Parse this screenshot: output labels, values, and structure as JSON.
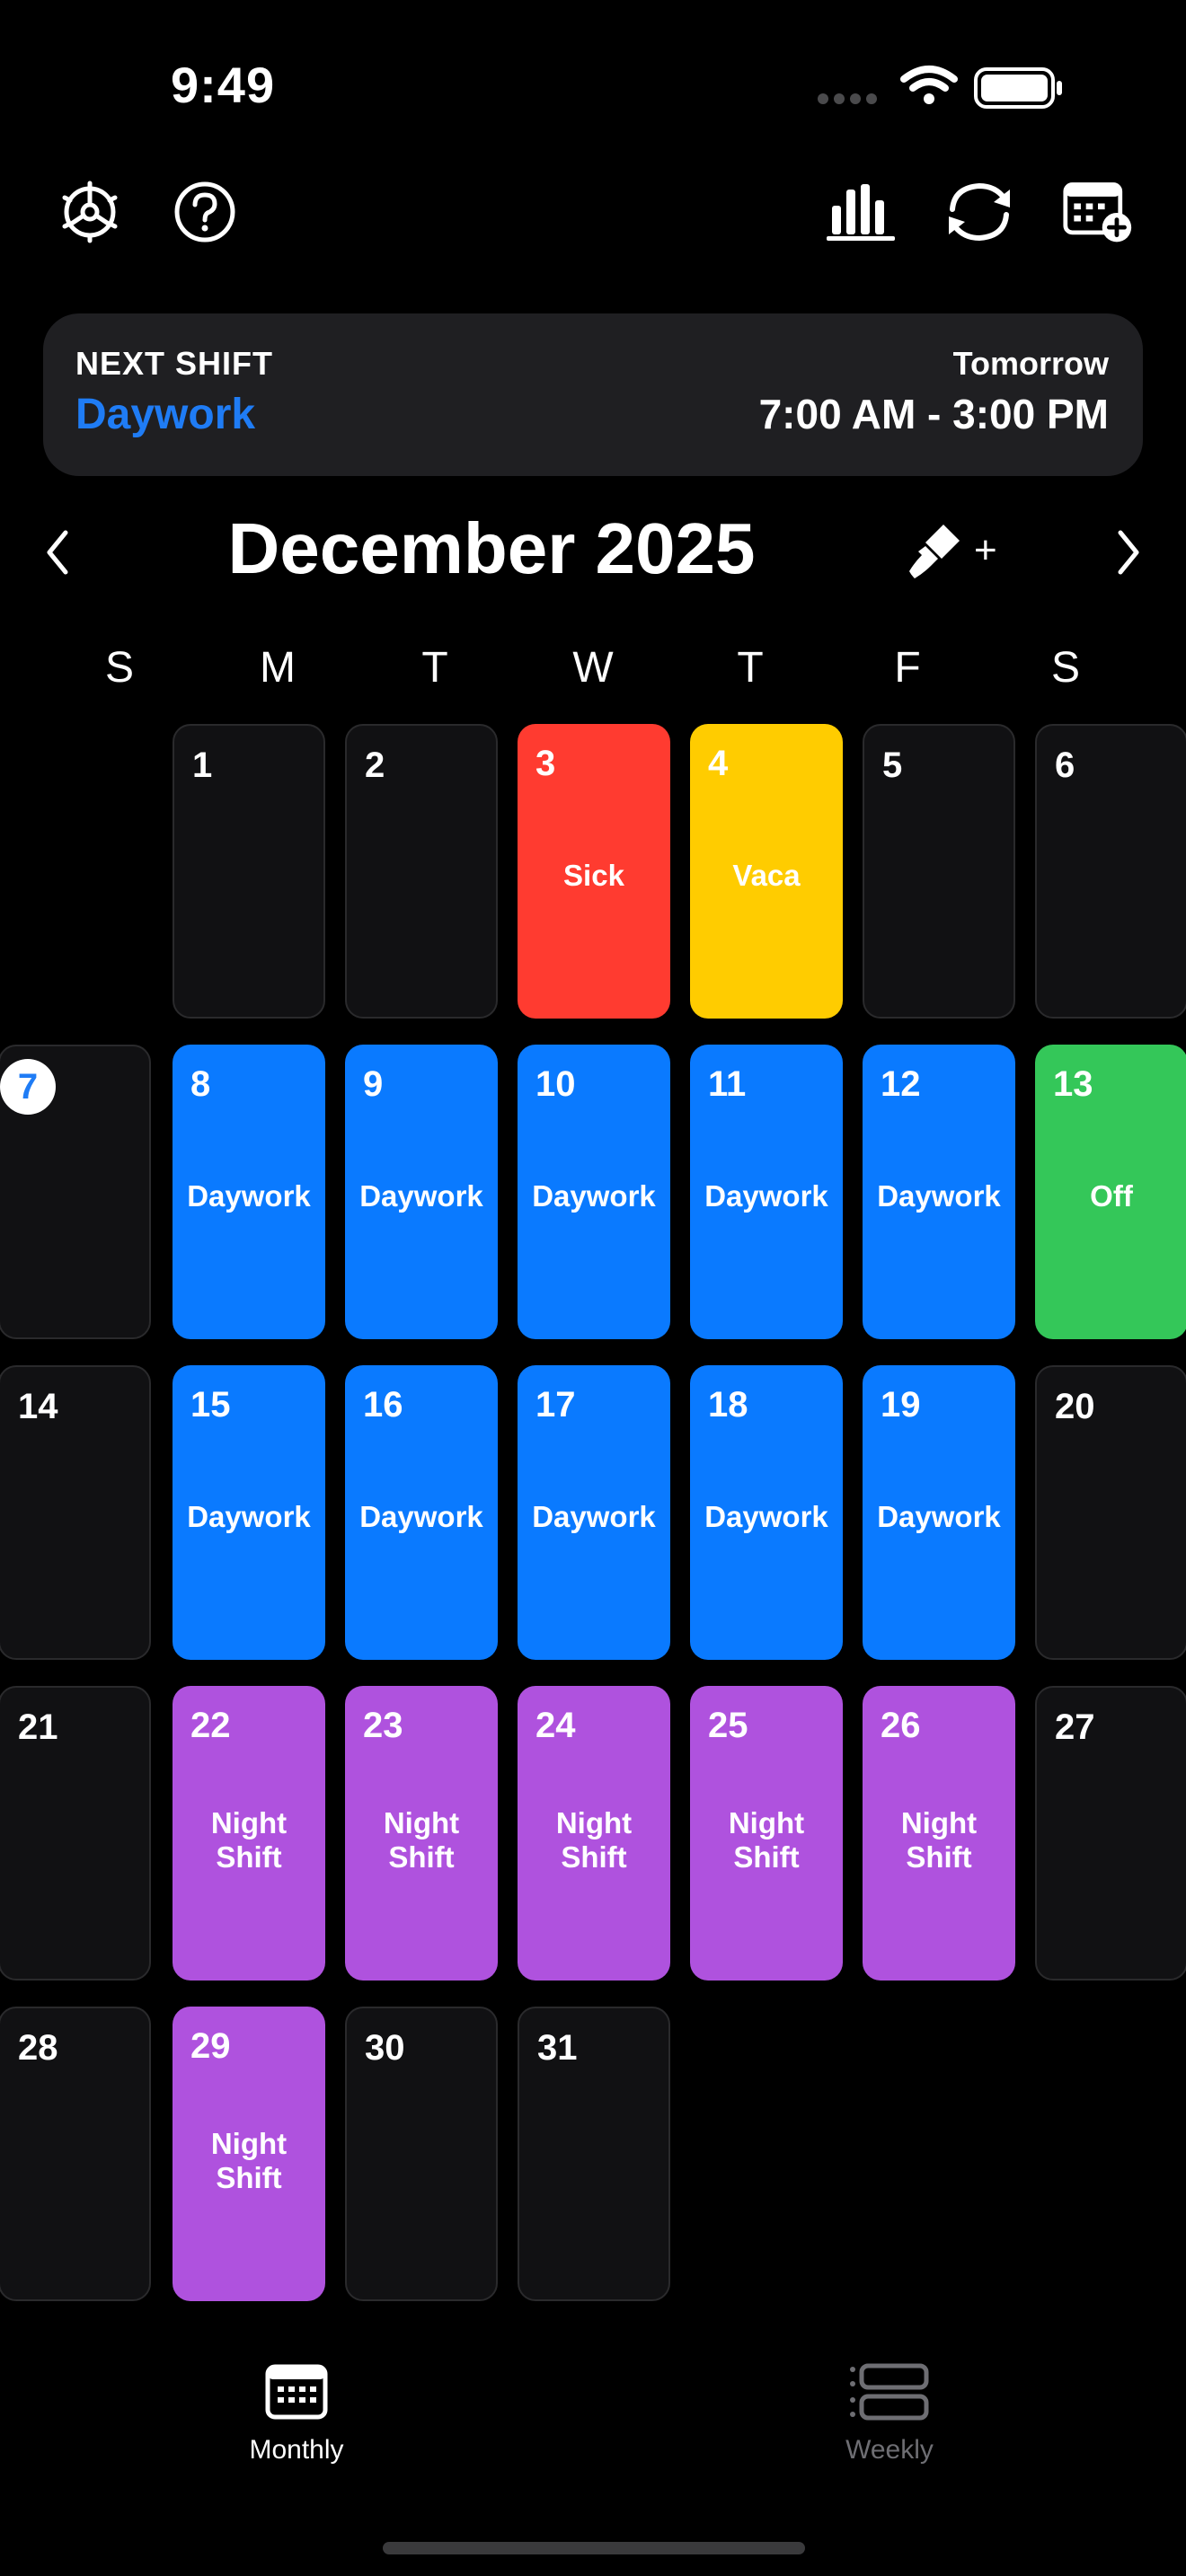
{
  "status_bar": {
    "time": "9:49"
  },
  "toolbar": {
    "left_icons": [
      "gear-icon",
      "help-icon"
    ],
    "right_icons": [
      "stats-chart-icon",
      "sync-icon",
      "calendar-add-icon"
    ]
  },
  "next_shift": {
    "label": "NEXT SHIFT",
    "name": "Daywork",
    "day": "Tomorrow",
    "time": "7:00 AM - 3:00 PM"
  },
  "calendar": {
    "month_title": "December 2025",
    "paint_plus": "+",
    "weekdays": [
      "S",
      "M",
      "T",
      "W",
      "T",
      "F",
      "S"
    ],
    "today": "7",
    "colors": {
      "daywork": "#0a7aff",
      "sick": "#ff3b30",
      "vaca": "#ffcc00",
      "off": "#34c759",
      "night": "#af52de",
      "empty": "#111113"
    },
    "days": [
      {
        "num": "1",
        "label": ""
      },
      {
        "num": "2",
        "label": ""
      },
      {
        "num": "3",
        "label": "Sick",
        "color": "sick"
      },
      {
        "num": "4",
        "label": "Vaca",
        "color": "vaca"
      },
      {
        "num": "5",
        "label": ""
      },
      {
        "num": "6",
        "label": ""
      },
      {
        "num": "7",
        "label": ""
      },
      {
        "num": "8",
        "label": "Daywork",
        "color": "daywork"
      },
      {
        "num": "9",
        "label": "Daywork",
        "color": "daywork"
      },
      {
        "num": "10",
        "label": "Daywork",
        "color": "daywork"
      },
      {
        "num": "11",
        "label": "Daywork",
        "color": "daywork"
      },
      {
        "num": "12",
        "label": "Daywork",
        "color": "daywork"
      },
      {
        "num": "13",
        "label": "Off",
        "color": "off"
      },
      {
        "num": "14",
        "label": ""
      },
      {
        "num": "15",
        "label": "Daywork",
        "color": "daywork"
      },
      {
        "num": "16",
        "label": "Daywork",
        "color": "daywork"
      },
      {
        "num": "17",
        "label": "Daywork",
        "color": "daywork"
      },
      {
        "num": "18",
        "label": "Daywork",
        "color": "daywork"
      },
      {
        "num": "19",
        "label": "Daywork",
        "color": "daywork"
      },
      {
        "num": "20",
        "label": ""
      },
      {
        "num": "21",
        "label": ""
      },
      {
        "num": "22",
        "label": "Night Shift",
        "color": "night"
      },
      {
        "num": "23",
        "label": "Night Shift",
        "color": "night"
      },
      {
        "num": "24",
        "label": "Night Shift",
        "color": "night"
      },
      {
        "num": "25",
        "label": "Night Shift",
        "color": "night"
      },
      {
        "num": "26",
        "label": "Night Shift",
        "color": "night"
      },
      {
        "num": "27",
        "label": ""
      },
      {
        "num": "28",
        "label": ""
      },
      {
        "num": "29",
        "label": "Night Shift",
        "color": "night"
      },
      {
        "num": "30",
        "label": ""
      },
      {
        "num": "31",
        "label": ""
      }
    ]
  },
  "tabs": [
    {
      "label": "Monthly",
      "icon": "calendar-grid-icon",
      "active": true
    },
    {
      "label": "Weekly",
      "icon": "week-rows-icon",
      "active": false
    }
  ]
}
